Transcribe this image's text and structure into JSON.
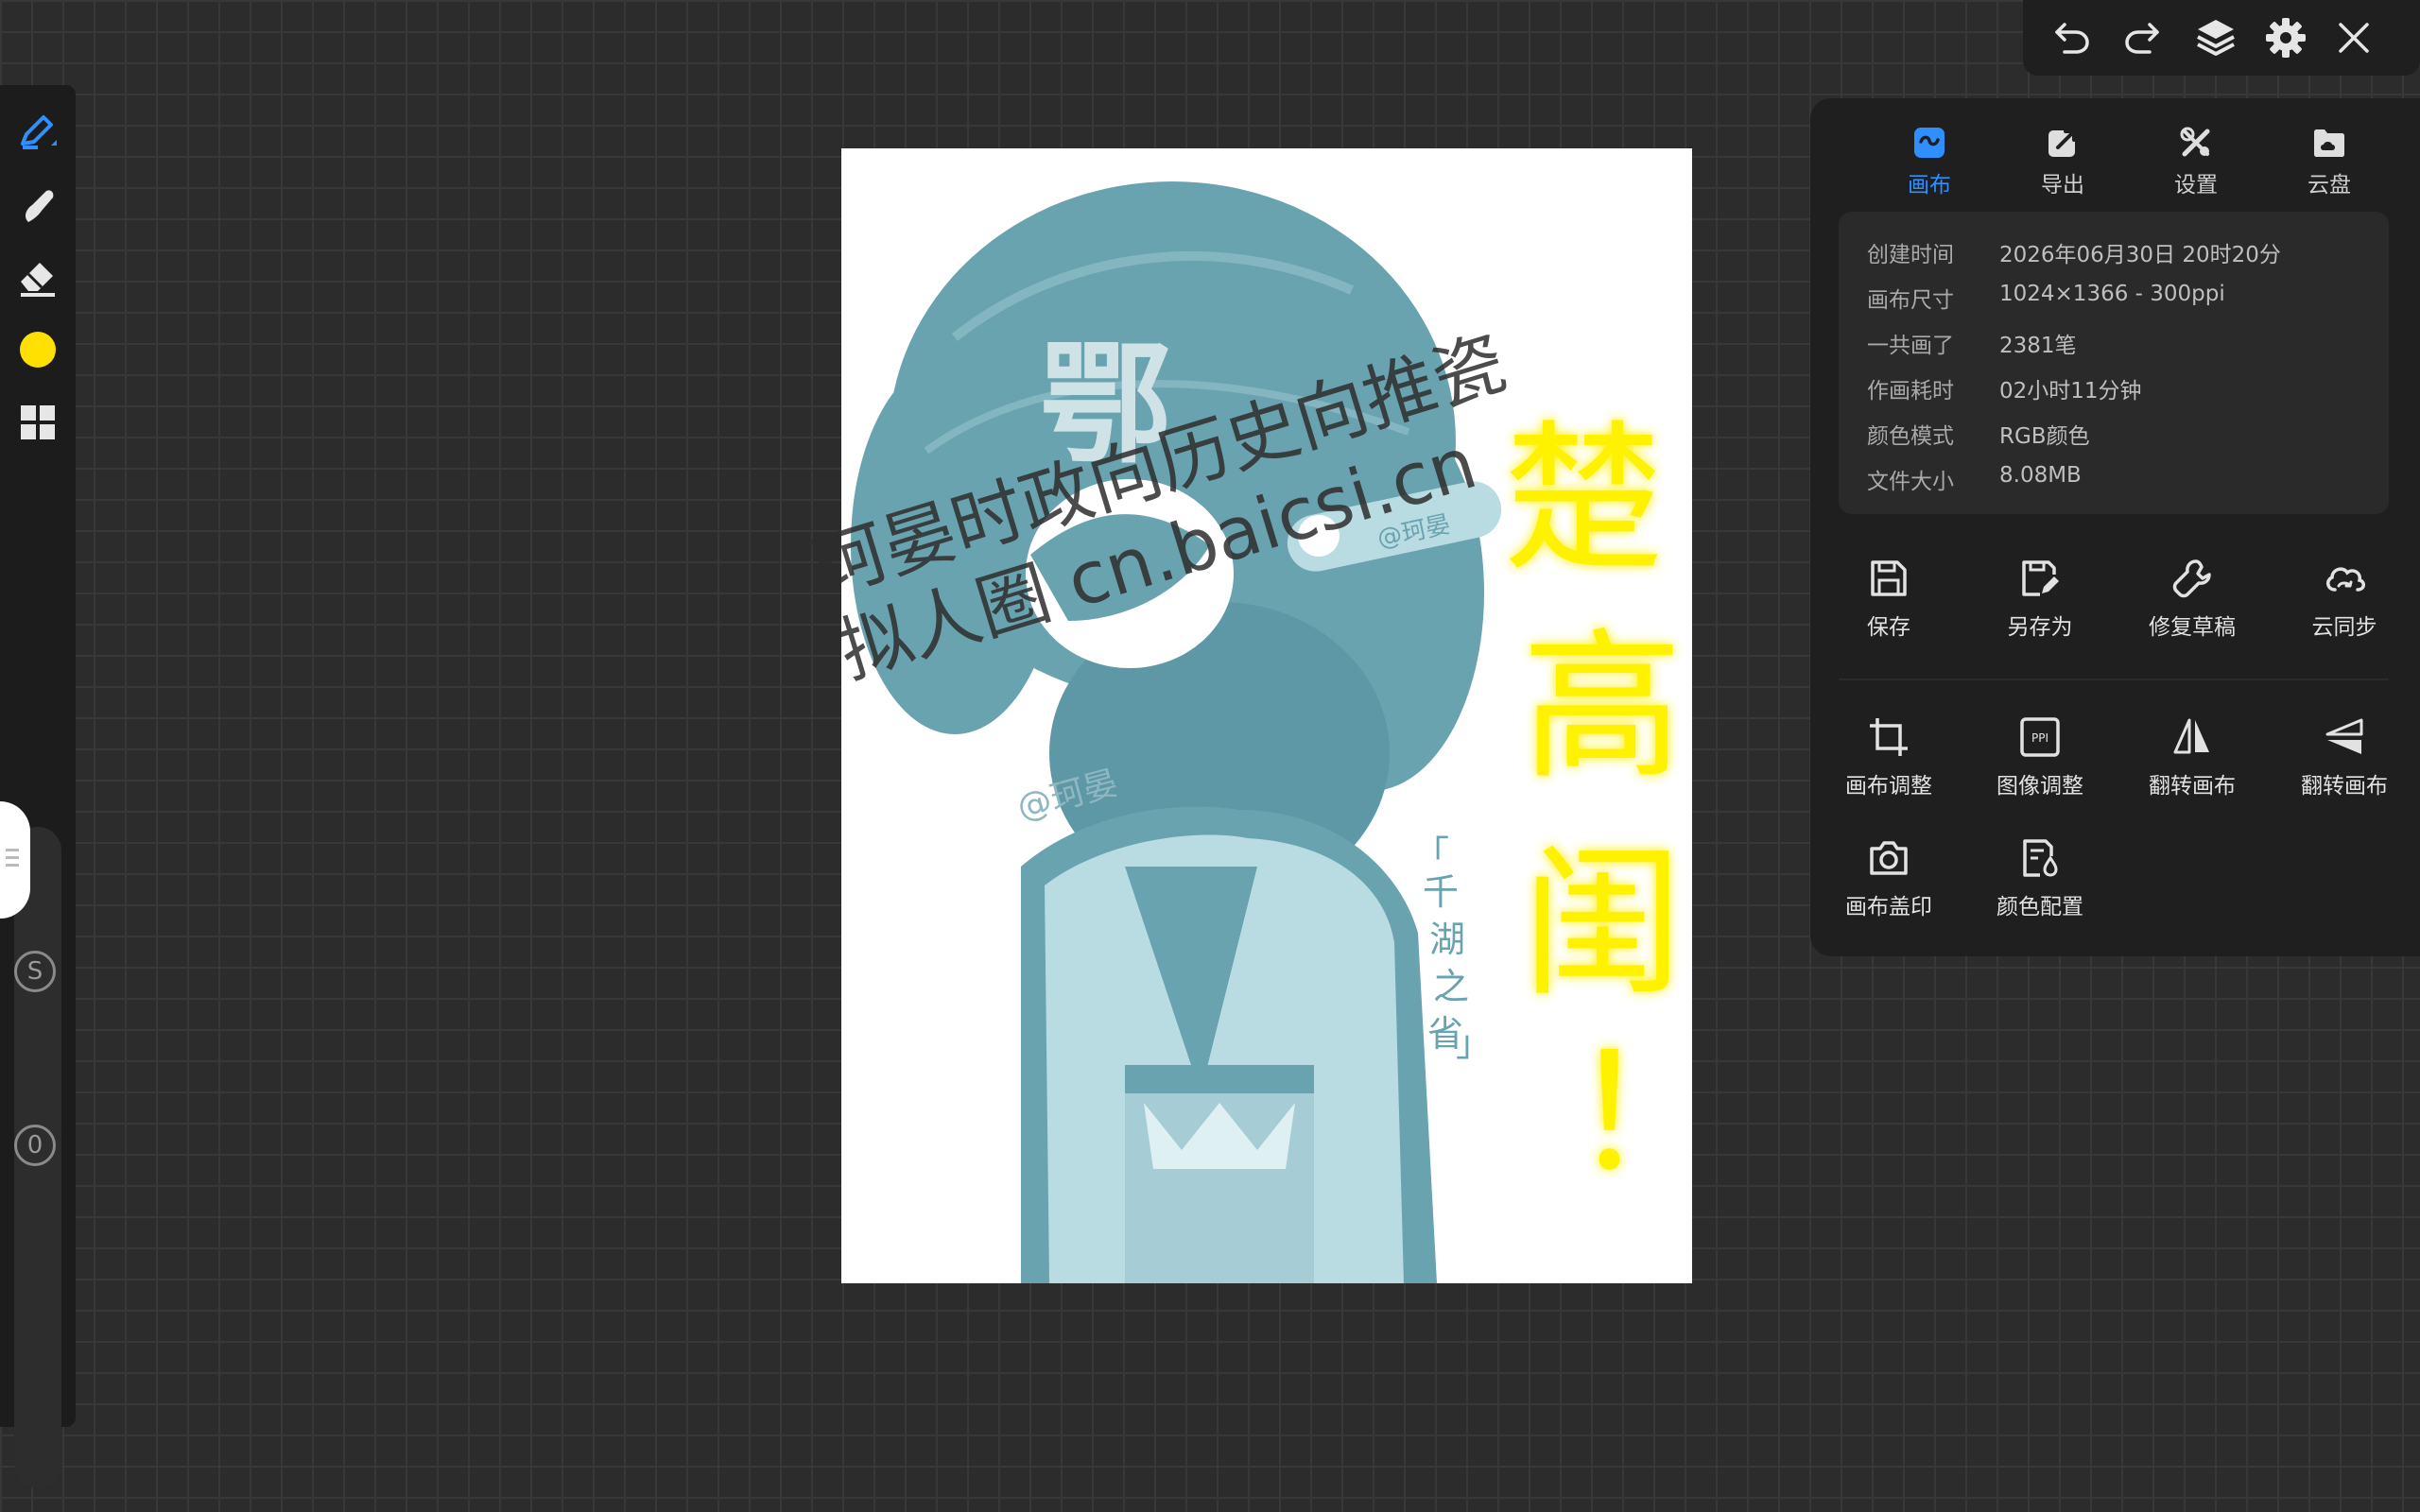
{
  "top_toolbar": {
    "undo": "undo-icon",
    "redo": "redo-icon",
    "layers": "layers-icon",
    "settings": "gear-icon",
    "close": "close-icon"
  },
  "left_toolbar": {
    "tools": [
      "pen-icon",
      "smudge-icon",
      "eraser-icon",
      "color-swatch",
      "grid-icon"
    ],
    "current_color": "#ffe000",
    "size_slider_label": "S",
    "opacity_slider_label": "0"
  },
  "panel": {
    "tabs": [
      {
        "label": "画布",
        "icon": "canvas-icon",
        "active": true
      },
      {
        "label": "导出",
        "icon": "export-icon",
        "active": false
      },
      {
        "label": "设置",
        "icon": "tools-icon",
        "active": false
      },
      {
        "label": "云盘",
        "icon": "cloud-drive-icon",
        "active": false
      }
    ],
    "info": [
      {
        "key": "创建时间",
        "value": "2026年06月30日 20时20分"
      },
      {
        "key": "画布尺寸",
        "value": "1024×1366 - 300ppi"
      },
      {
        "key": "一共画了",
        "value": "2381笔"
      },
      {
        "key": "作画耗时",
        "value": "02小时11分钟"
      },
      {
        "key": "颜色模式",
        "value": "RGB颜色"
      },
      {
        "key": "文件大小",
        "value": "8.08MB"
      }
    ],
    "actions_row1": [
      {
        "label": "保存",
        "icon": "save-icon"
      },
      {
        "label": "另存为",
        "icon": "save-as-icon"
      },
      {
        "label": "修复草稿",
        "icon": "wrench-icon"
      },
      {
        "label": "云同步",
        "icon": "cloud-sync-icon"
      }
    ],
    "actions_row2": [
      {
        "label": "画布调整",
        "icon": "crop-icon"
      },
      {
        "label": "图像调整",
        "icon": "ppi-icon"
      },
      {
        "label": "翻转画布",
        "icon": "flip-horizontal-icon"
      },
      {
        "label": "翻转画布",
        "icon": "flip-vertical-icon"
      }
    ],
    "actions_row3": [
      {
        "label": "画布盖印",
        "icon": "camera-stamp-icon"
      },
      {
        "label": "颜色配置",
        "icon": "color-config-icon"
      }
    ]
  },
  "artwork": {
    "hair_text": "鄂",
    "hairpin_text": "@珂晏",
    "signature_text": "@珂晏",
    "vertical_text": "「千湖之省」",
    "yellow_text": "楚高闺！",
    "accent_color": "#6aa3b0"
  },
  "watermark": {
    "line1": "珂晏时政向历史向推瓷",
    "line2": "拟人圈 cn.baicsi.cn"
  }
}
